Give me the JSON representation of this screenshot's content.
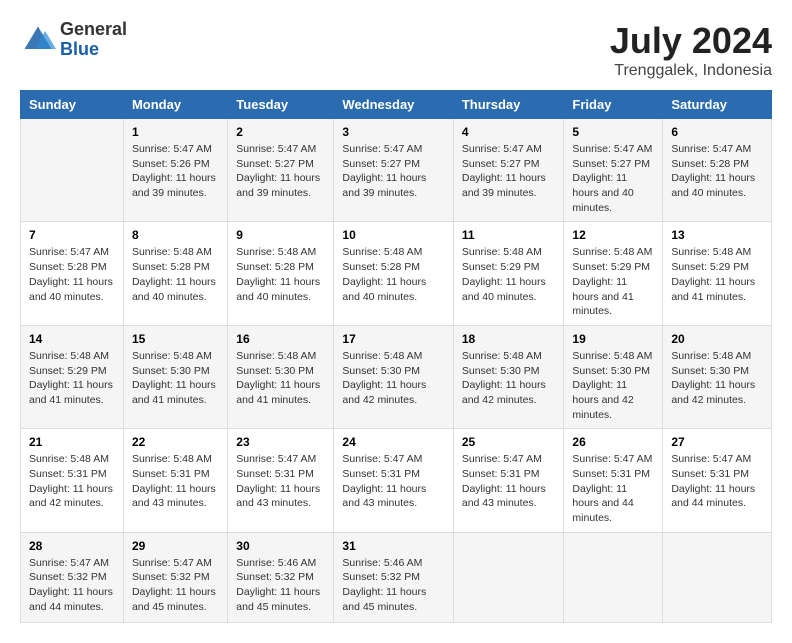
{
  "header": {
    "logo_general": "General",
    "logo_blue": "Blue",
    "title": "July 2024",
    "subtitle": "Trenggalek, Indonesia"
  },
  "days_of_week": [
    "Sunday",
    "Monday",
    "Tuesday",
    "Wednesday",
    "Thursday",
    "Friday",
    "Saturday"
  ],
  "weeks": [
    [
      {
        "day": "",
        "info": ""
      },
      {
        "day": "1",
        "sunrise": "5:47 AM",
        "sunset": "5:26 PM",
        "daylight": "11 hours and 39 minutes."
      },
      {
        "day": "2",
        "sunrise": "5:47 AM",
        "sunset": "5:27 PM",
        "daylight": "11 hours and 39 minutes."
      },
      {
        "day": "3",
        "sunrise": "5:47 AM",
        "sunset": "5:27 PM",
        "daylight": "11 hours and 39 minutes."
      },
      {
        "day": "4",
        "sunrise": "5:47 AM",
        "sunset": "5:27 PM",
        "daylight": "11 hours and 39 minutes."
      },
      {
        "day": "5",
        "sunrise": "5:47 AM",
        "sunset": "5:27 PM",
        "daylight": "11 hours and 40 minutes."
      },
      {
        "day": "6",
        "sunrise": "5:47 AM",
        "sunset": "5:28 PM",
        "daylight": "11 hours and 40 minutes."
      }
    ],
    [
      {
        "day": "7",
        "sunrise": "5:47 AM",
        "sunset": "5:28 PM",
        "daylight": "11 hours and 40 minutes."
      },
      {
        "day": "8",
        "sunrise": "5:48 AM",
        "sunset": "5:28 PM",
        "daylight": "11 hours and 40 minutes."
      },
      {
        "day": "9",
        "sunrise": "5:48 AM",
        "sunset": "5:28 PM",
        "daylight": "11 hours and 40 minutes."
      },
      {
        "day": "10",
        "sunrise": "5:48 AM",
        "sunset": "5:28 PM",
        "daylight": "11 hours and 40 minutes."
      },
      {
        "day": "11",
        "sunrise": "5:48 AM",
        "sunset": "5:29 PM",
        "daylight": "11 hours and 40 minutes."
      },
      {
        "day": "12",
        "sunrise": "5:48 AM",
        "sunset": "5:29 PM",
        "daylight": "11 hours and 41 minutes."
      },
      {
        "day": "13",
        "sunrise": "5:48 AM",
        "sunset": "5:29 PM",
        "daylight": "11 hours and 41 minutes."
      }
    ],
    [
      {
        "day": "14",
        "sunrise": "5:48 AM",
        "sunset": "5:29 PM",
        "daylight": "11 hours and 41 minutes."
      },
      {
        "day": "15",
        "sunrise": "5:48 AM",
        "sunset": "5:30 PM",
        "daylight": "11 hours and 41 minutes."
      },
      {
        "day": "16",
        "sunrise": "5:48 AM",
        "sunset": "5:30 PM",
        "daylight": "11 hours and 41 minutes."
      },
      {
        "day": "17",
        "sunrise": "5:48 AM",
        "sunset": "5:30 PM",
        "daylight": "11 hours and 42 minutes."
      },
      {
        "day": "18",
        "sunrise": "5:48 AM",
        "sunset": "5:30 PM",
        "daylight": "11 hours and 42 minutes."
      },
      {
        "day": "19",
        "sunrise": "5:48 AM",
        "sunset": "5:30 PM",
        "daylight": "11 hours and 42 minutes."
      },
      {
        "day": "20",
        "sunrise": "5:48 AM",
        "sunset": "5:30 PM",
        "daylight": "11 hours and 42 minutes."
      }
    ],
    [
      {
        "day": "21",
        "sunrise": "5:48 AM",
        "sunset": "5:31 PM",
        "daylight": "11 hours and 42 minutes."
      },
      {
        "day": "22",
        "sunrise": "5:48 AM",
        "sunset": "5:31 PM",
        "daylight": "11 hours and 43 minutes."
      },
      {
        "day": "23",
        "sunrise": "5:47 AM",
        "sunset": "5:31 PM",
        "daylight": "11 hours and 43 minutes."
      },
      {
        "day": "24",
        "sunrise": "5:47 AM",
        "sunset": "5:31 PM",
        "daylight": "11 hours and 43 minutes."
      },
      {
        "day": "25",
        "sunrise": "5:47 AM",
        "sunset": "5:31 PM",
        "daylight": "11 hours and 43 minutes."
      },
      {
        "day": "26",
        "sunrise": "5:47 AM",
        "sunset": "5:31 PM",
        "daylight": "11 hours and 44 minutes."
      },
      {
        "day": "27",
        "sunrise": "5:47 AM",
        "sunset": "5:31 PM",
        "daylight": "11 hours and 44 minutes."
      }
    ],
    [
      {
        "day": "28",
        "sunrise": "5:47 AM",
        "sunset": "5:32 PM",
        "daylight": "11 hours and 44 minutes."
      },
      {
        "day": "29",
        "sunrise": "5:47 AM",
        "sunset": "5:32 PM",
        "daylight": "11 hours and 45 minutes."
      },
      {
        "day": "30",
        "sunrise": "5:46 AM",
        "sunset": "5:32 PM",
        "daylight": "11 hours and 45 minutes."
      },
      {
        "day": "31",
        "sunrise": "5:46 AM",
        "sunset": "5:32 PM",
        "daylight": "11 hours and 45 minutes."
      },
      {
        "day": "",
        "info": ""
      },
      {
        "day": "",
        "info": ""
      },
      {
        "day": "",
        "info": ""
      }
    ]
  ]
}
